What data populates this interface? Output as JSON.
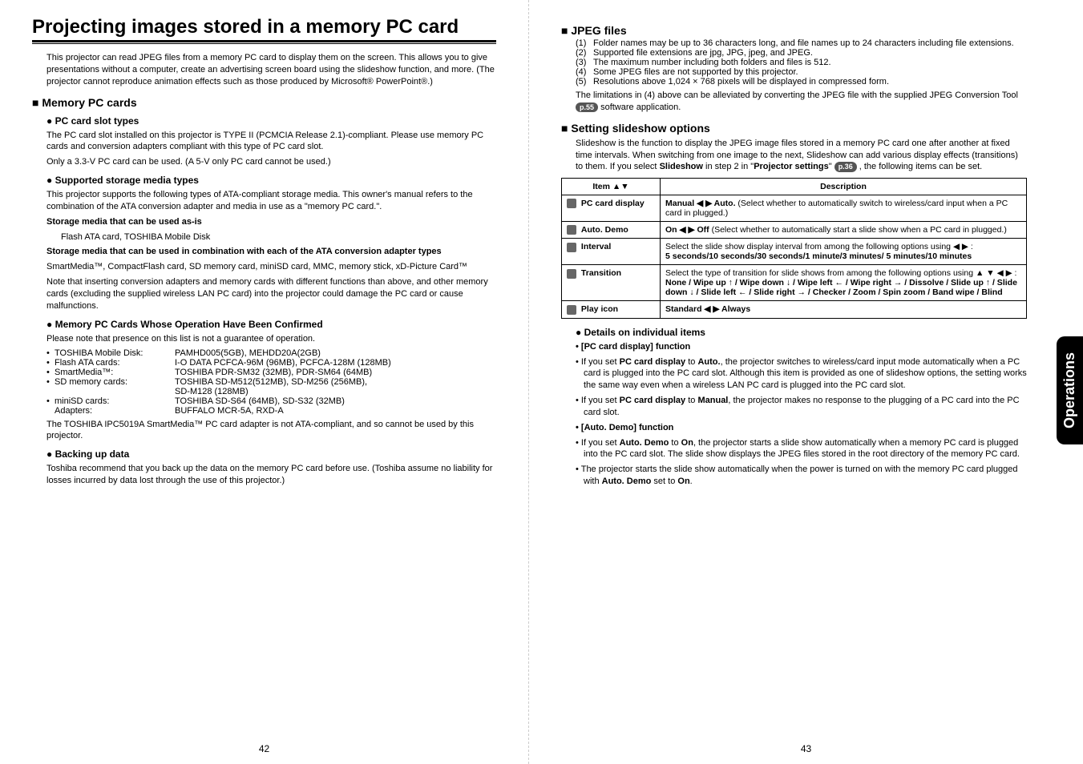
{
  "side_tab": "Operations",
  "page_num_left": "42",
  "page_num_right": "43",
  "left": {
    "title": "Projecting images stored in a memory PC card",
    "intro": "This projector can read JPEG files from a memory PC card to display them on the screen. This allows you to give presentations without a computer, create an advertising screen board using the slideshow function, and more. (The projector cannot reproduce animation effects such as those produced by Microsoft® PowerPoint®.)",
    "h2_memory": "Memory PC cards",
    "h3_slot": "PC card slot types",
    "slot_p1": "The PC card slot installed on this projector is TYPE II (PCMCIA Release 2.1)-compliant. Please use memory PC cards and conversion adapters compliant with this type of PC card slot.",
    "slot_p2": "Only a 3.3-V PC card can be used. (A 5-V only PC card cannot be used.)",
    "h3_media": "Supported storage media types",
    "media_p1": "This projector supports the following types of ATA-compliant storage media. This owner's manual refers to the combination of the ATA conversion adapter and media in use as a \"memory PC card.\".",
    "media_b1": "Storage media that can be used as-is",
    "media_b1_sub": "Flash ATA card, TOSHIBA Mobile Disk",
    "media_b2": "Storage media that can be used in combination with each of the ATA conversion adapter types",
    "media_b2_sub": "SmartMedia™, CompactFlash card, SD memory card, miniSD card, MMC, memory stick, xD-Picture Card™",
    "media_note": "Note that inserting conversion adapters and memory cards with different functions than above, and other memory cards (excluding the supplied wireless LAN PC card) into the projector could damage the PC card or cause malfunctions.",
    "h3_confirmed": "Memory PC Cards Whose Operation Have Been Confirmed",
    "confirmed_note": "Please note that presence on this list is not a guarantee of operation.",
    "rows": [
      {
        "label": "TOSHIBA Mobile Disk:",
        "val": "PAMHD005(5GB), MEHDD20A(2GB)"
      },
      {
        "label": "Flash ATA cards:",
        "val": "I-O DATA PCFCA-96M (96MB), PCFCA-128M (128MB)"
      },
      {
        "label": "SmartMedia™:",
        "val": "TOSHIBA PDR-SM32 (32MB), PDR-SM64 (64MB)"
      },
      {
        "label": "SD memory cards:",
        "val": "TOSHIBA SD-M512(512MB), SD-M256 (256MB),"
      },
      {
        "label": "",
        "val": "SD-M128 (128MB)"
      },
      {
        "label": "miniSD cards:",
        "val": "TOSHIBA SD-S64 (64MB), SD-S32 (32MB)"
      },
      {
        "label": "Adapters:",
        "val": "BUFFALO MCR-5A, RXD-A",
        "nodot": true
      }
    ],
    "confirmed_end": "The TOSHIBA IPC5019A SmartMedia™ PC card adapter is not ATA-compliant, and so cannot be used by this projector.",
    "h3_backup": "Backing up data",
    "backup_p": "Toshiba recommend that you back up the data on the memory PC card before use. (Toshiba assume no liability for losses incurred by data lost through the use of this projector.)"
  },
  "right": {
    "h2_jpeg": "JPEG files",
    "jpeg_list": [
      "Folder names may be up to 36 characters long, and file names up to 24 characters including file extensions.",
      "Supported file extensions are jpg, JPG, jpeg, and JPEG.",
      "The maximum number including both folders and files is 512.",
      "Some JPEG files are not supported by this projector.",
      "Resolutions above 1,024 × 768 pixels will be displayed in compressed form."
    ],
    "jpeg_end_a": "The limitations in (4) above can be alleviated by converting the JPEG file with the supplied JPEG Conversion Tool ",
    "jpeg_pill": "p.55",
    "jpeg_end_b": " software application.",
    "h2_slideshow": "Setting slideshow options",
    "slideshow_p_a": "Slideshow is the function to display the JPEG image files stored in a memory PC card one after another at fixed time intervals. When switching from one image to the next, Slideshow can add various display effects (transitions) to them. If you select ",
    "slideshow_bold": "Slideshow",
    "slideshow_p_b": " in step 2 in \"",
    "slideshow_bold2": "Projector settings",
    "slideshow_p_c": "\" ",
    "slideshow_pill": "p.36",
    "slideshow_p_d": " , the following items can be set.",
    "table": {
      "head_item": "Item",
      "head_desc": "Description",
      "rows": [
        {
          "item": "PC card display",
          "desc_bold": "Manual ◀ ▶ Auto.",
          "desc_rest": " (Select whether to automatically switch to wireless/card input when a PC card in plugged.)"
        },
        {
          "item": "Auto. Demo",
          "desc_bold": "On ◀ ▶ Off",
          "desc_rest": " (Select whether to automatically start a slide show when a PC card in plugged.)"
        },
        {
          "item": "Interval",
          "desc_pre": "Select the slide show display interval from among the following options using ◀ ▶ :",
          "desc_bold2": "5 seconds/10 seconds/30 seconds/1 minute/3 minutes/ 5 minutes/10 minutes"
        },
        {
          "item": "Transition",
          "desc_pre": "Select the type of transition for slide shows from among the following options using ▲ ▼ ◀ ▶ :",
          "desc_bold2": "None / Wipe up ↑ / Wipe down ↓ / Wipe left ← / Wipe right → / Dissolve / Slide up ↑ / Slide down ↓ / Slide left ← / Slide right → / Checker / Zoom / Spin zoom / Band wipe / Blind"
        },
        {
          "item": "Play icon",
          "desc_bold": "Standard ◀ ▶ Always",
          "desc_rest": ""
        }
      ]
    },
    "h3_details": "Details on individual items",
    "sec_pc_title": "[PC card display] function",
    "sec_pc_b1_a": "If you set ",
    "sec_pc_b1_b": "PC card display",
    "sec_pc_b1_c": " to ",
    "sec_pc_b1_d": "Auto.",
    "sec_pc_b1_e": ", the projector switches to wireless/card input mode automatically when a PC card is plugged into the PC card slot. Although this item is provided as one of slideshow options, the setting works the same way even when a wireless LAN PC card is plugged into the PC card slot.",
    "sec_pc_b2_a": "If you set ",
    "sec_pc_b2_b": "PC card display",
    "sec_pc_b2_c": " to ",
    "sec_pc_b2_d": "Manual",
    "sec_pc_b2_e": ", the projector makes no response to the plugging of a PC card into the PC card slot.",
    "sec_ad_title": "[Auto. Demo] function",
    "sec_ad_b1_a": "If you set ",
    "sec_ad_b1_b": "Auto. Demo",
    "sec_ad_b1_c": " to ",
    "sec_ad_b1_d": "On",
    "sec_ad_b1_e": ", the projector starts a slide show automatically when a memory PC card is plugged into the PC card slot. The slide show displays the JPEG files stored in the root directory of the memory PC card.",
    "sec_ad_b2_a": "The projector starts the slide show automatically when the power is turned on with the memory PC card plugged with ",
    "sec_ad_b2_b": "Auto. Demo",
    "sec_ad_b2_c": " set to ",
    "sec_ad_b2_d": "On",
    "sec_ad_b2_e": "."
  }
}
